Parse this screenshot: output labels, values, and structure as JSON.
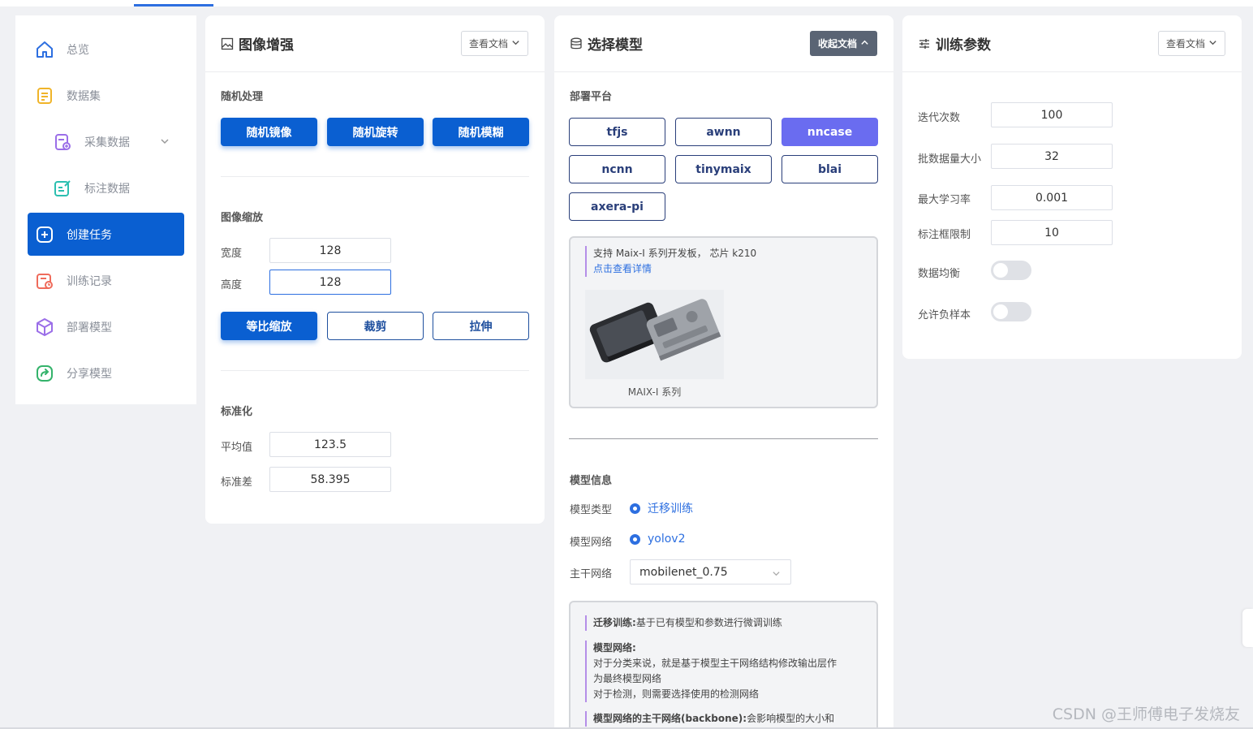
{
  "sidebar": {
    "items": [
      {
        "label": "总览"
      },
      {
        "label": "数据集"
      },
      {
        "label": "采集数据"
      },
      {
        "label": "标注数据"
      },
      {
        "label": "创建任务"
      },
      {
        "label": "训练记录"
      },
      {
        "label": "部署模型"
      },
      {
        "label": "分享模型"
      }
    ]
  },
  "augment": {
    "title": "图像增强",
    "doc_button": "查看文档",
    "random_title": "随机处理",
    "random_buttons": [
      "随机镜像",
      "随机旋转",
      "随机模糊"
    ],
    "scale_title": "图像缩放",
    "width_label": "宽度",
    "width_value": "128",
    "height_label": "高度",
    "height_value": "128",
    "scale_buttons": [
      "等比缩放",
      "裁剪",
      "拉伸"
    ],
    "norm_title": "标准化",
    "mean_label": "平均值",
    "mean_value": "123.5",
    "std_label": "标准差",
    "std_value": "58.395"
  },
  "model": {
    "title": "选择模型",
    "doc_button": "收起文档",
    "platform_title": "部署平台",
    "platforms": [
      "tfjs",
      "awnn",
      "nncase",
      "ncnn",
      "tinymaix",
      "blai",
      "axera-pi"
    ],
    "selected_platform": "nncase",
    "platform_info": "支持 Maix-I 系列开发板， 芯片 k210",
    "platform_link": "点击查看详情",
    "board_caption": "MAIX-I 系列",
    "info_title": "模型信息",
    "type_label": "模型类型",
    "type_value": "迁移训练",
    "net_label": "模型网络",
    "net_value": "yolov2",
    "backbone_label": "主干网络",
    "backbone_value": "mobilenet_0.75",
    "note1_bold": "迁移训练:",
    "note1_text": "基于已有模型和参数进行微调训练",
    "note2_bold": "模型网络:",
    "note2_line1": "对于分类来说，就是基于模型主干网络结构修改输出层作",
    "note2_line2": "为最终模型网络",
    "note2_line3": "对于检测，则需要选择使用的检测网络",
    "note3_bold": "模型网络的主干网络(backbone):",
    "note3_text": "会影响模型的大小和"
  },
  "train": {
    "title": "训练参数",
    "doc_button": "查看文档",
    "epochs_label": "迭代次数",
    "epochs_value": "100",
    "batch_label": "批数据量大小",
    "batch_value": "32",
    "lr_label": "最大学习率",
    "lr_value": "0.001",
    "bbox_label": "标注框限制",
    "bbox_value": "10",
    "balance_label": "数据均衡",
    "balance_on": false,
    "negative_label": "允许负样本",
    "negative_on": false
  },
  "watermark": "CSDN @王师傅电子发烧友",
  "colors": {
    "primary": "#0a5fd1",
    "platform_selected": "#6a6cf0",
    "accent_link": "#2d6fe0"
  }
}
